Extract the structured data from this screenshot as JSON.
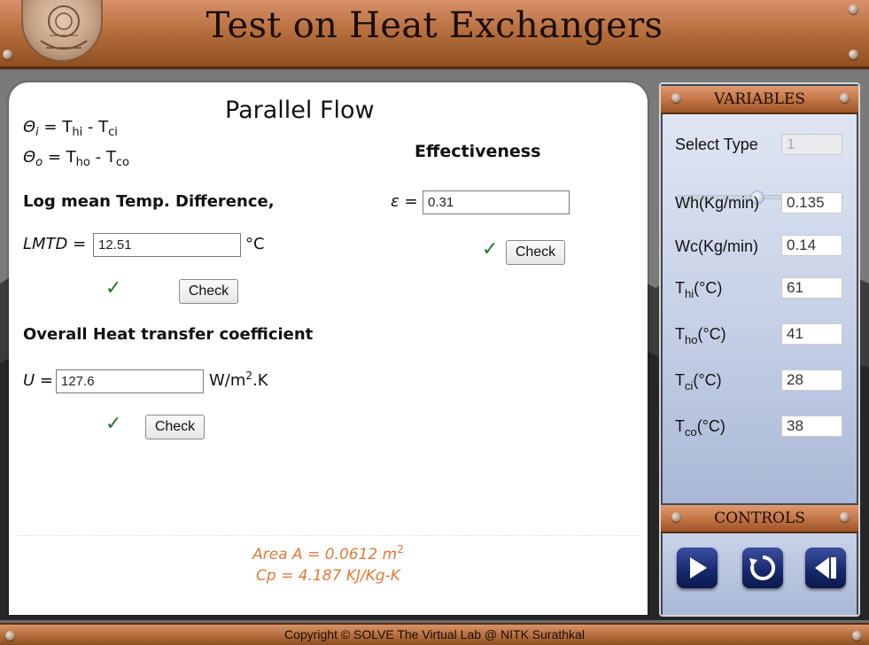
{
  "header": {
    "title": "Test on Heat Exchangers"
  },
  "main": {
    "title": "Parallel Flow",
    "theta_i": {
      "lhs": "Θ",
      "lhs_sub": "i",
      "t1": "T",
      "t1_sub": "hi",
      "t2": "T",
      "t2_sub": "ci"
    },
    "theta_o": {
      "lhs": "Θ",
      "lhs_sub": "o",
      "t1": "T",
      "t1_sub": "ho",
      "t2": "T",
      "t2_sub": "co"
    },
    "lmtd": {
      "heading": "Log mean Temp. Difference,",
      "label": "LMTD =",
      "value": "12.51",
      "unit": "°C",
      "check_label": "Check",
      "tick": "✓"
    },
    "effectiveness": {
      "heading": "Effectiveness",
      "label": "ε =",
      "value": "0.31",
      "check_label": "Check",
      "tick": "✓"
    },
    "u": {
      "heading": "Overall Heat transfer coefficient",
      "label": "U =",
      "value": "127.6",
      "unit_base": "W/m",
      "unit_sup": "2",
      "unit_tail": ".K",
      "check_label": "Check",
      "tick": "✓"
    },
    "footnote": {
      "area_label": "Area A = 0.0612 m",
      "area_sup": "2",
      "cp_label": "Cp = 4.187 KJ/Kg-K"
    }
  },
  "variables": {
    "header": "VARIABLES",
    "select_type_label": "Select Type",
    "select_type_value": "1",
    "slider_level": 0.5,
    "items": [
      {
        "label": "Wh(Kg/min)",
        "sub": "",
        "unit": "",
        "value": "0.135"
      },
      {
        "label": "Wc(Kg/min)",
        "sub": "",
        "unit": "",
        "value": "0.14"
      },
      {
        "label": "T",
        "sub": "hi",
        "unit": "(°C)",
        "value": "61"
      },
      {
        "label": "T",
        "sub": "ho",
        "unit": "(°C)",
        "value": "41"
      },
      {
        "label": "T",
        "sub": "ci",
        "unit": "(°C)",
        "value": "28"
      },
      {
        "label": "T",
        "sub": "co",
        "unit": "(°C)",
        "value": "38"
      }
    ]
  },
  "controls": {
    "header": "CONTROLS",
    "buttons": [
      "play-icon",
      "reset-icon",
      "step-back-icon"
    ]
  },
  "footer": {
    "copyright": "Copyright © SOLVE The Virtual Lab @ NITK Surathkal"
  },
  "colors": {
    "copper": "#b8703f",
    "check_green": "#1c7a2a",
    "note_orange": "#e07a38",
    "control_blue": "#16276a"
  }
}
